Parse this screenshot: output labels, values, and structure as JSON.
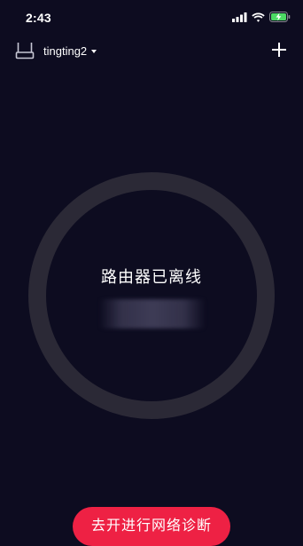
{
  "status_bar": {
    "time": "2:43",
    "icons": [
      "cellular-signal-icon",
      "wifi-icon",
      "battery-charging-icon"
    ],
    "battery_color": "#4cd964"
  },
  "header": {
    "router_icon": "router-icon",
    "router_name": "tingting2",
    "dropdown_icon": "caret-down-icon",
    "add_icon": "plus-icon"
  },
  "main": {
    "status_text": "路由器已离线",
    "ring_color": "#2b2936"
  },
  "bottom": {
    "button_label": "去开进行网络诊断",
    "button_color": "#ee2144"
  },
  "colors": {
    "background": "#0d0c20",
    "text": "#ffffff"
  }
}
